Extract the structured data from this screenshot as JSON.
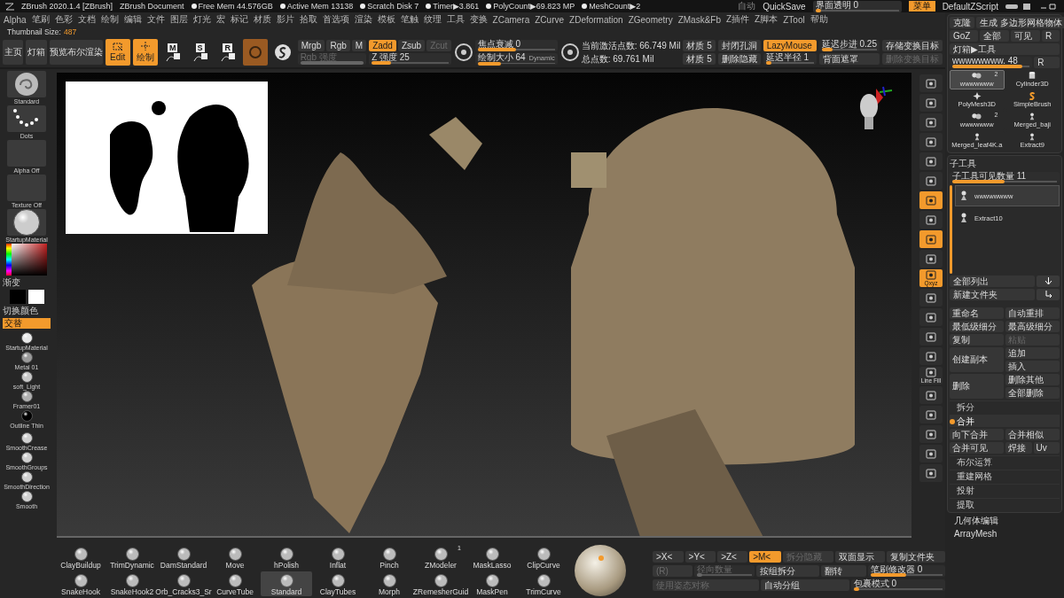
{
  "title_bar": {
    "app": "ZBrush 2020.1.4 [ZBrush]",
    "document": "ZBrush Document",
    "stats": [
      "Free Mem 44.576GB",
      "Active Mem 13138",
      "Scratch Disk 7",
      "Timer▶3.861",
      "PolyCount▶69.823 MP",
      "MeshCount▶2"
    ],
    "auto": "自动",
    "quicksave": "QuickSave",
    "opacity": {
      "label": "界面透明 0",
      "level": 0.05,
      "disabled": false
    },
    "menu_button": {
      "label": "菜单",
      "selected": true
    },
    "script": "DefaultZScript"
  },
  "menu": [
    "Alpha",
    "笔刷",
    "色彩",
    "文档",
    "绘制",
    "编辑",
    "文件",
    "图层",
    "灯光",
    "宏",
    "标记",
    "材质",
    "影片",
    "拾取",
    "首选项",
    "渲染",
    "模板",
    "笔触",
    "纹理",
    "工具",
    "变换",
    "ZCamera",
    "ZCurve",
    "ZDeformation",
    "ZGeometry",
    "ZMask&Fb",
    "Z插件",
    "Z脚本",
    "ZTool",
    "帮助"
  ],
  "thumbnail_size": {
    "label": "Thumbnail Size:",
    "value": "487"
  },
  "toolbar": {
    "nav": [
      "主页",
      "灯箱",
      "预览布尔渲染"
    ],
    "modes": [
      {
        "kind": "edit",
        "label": "Edit",
        "selected": true
      },
      {
        "kind": "draw",
        "label": "绘制",
        "selected": true
      },
      {
        "kind": "letter",
        "label": "M",
        "selected": false
      },
      {
        "kind": "letter",
        "label": "S",
        "selected": false
      },
      {
        "kind": "letter",
        "label": "R",
        "selected": false
      },
      {
        "kind": "material",
        "selected": true
      },
      {
        "kind": "shader",
        "selected": false
      }
    ],
    "groups": [
      {
        "kind": "plain",
        "rows": [
          [
            {
              "kind": "button",
              "label": "Mrgb",
              "selected": false,
              "disabled": false
            },
            {
              "kind": "button",
              "label": "Rgb",
              "selected": false,
              "disabled": false
            },
            {
              "kind": "button",
              "label": "M",
              "selected": false,
              "disabled": false
            }
          ],
          [
            {
              "kind": "slider",
              "label": "Rgb 强度",
              "level": 1,
              "disabled": true
            }
          ]
        ]
      },
      {
        "kind": "plain",
        "rows": [
          [
            {
              "kind": "button",
              "label": "Zadd",
              "selected": true,
              "disabled": false
            },
            {
              "kind": "button",
              "label": "Zsub",
              "selected": false,
              "disabled": false
            },
            {
              "kind": "button",
              "label": "Zcut",
              "selected": false,
              "disabled": true
            }
          ],
          [
            {
              "kind": "slider",
              "label": "Z 强度 25",
              "level": 0.25,
              "disabled": false
            }
          ]
        ]
      },
      {
        "kind": "target",
        "rows": [
          [
            {
              "kind": "slider",
              "label": "焦点衰减 0",
              "level": 0.5,
              "disabled": false
            }
          ],
          [
            {
              "kind": "slider",
              "label": "绘制大小 64",
              "tag": "Dynamic",
              "level": 0.3,
              "disabled": false
            }
          ]
        ]
      },
      {
        "kind": "target",
        "rows": [
          [
            {
              "kind": "text",
              "label": "当前激活点数: 66.749 Mil"
            }
          ],
          [
            {
              "kind": "text",
              "label": "总点数: 69.761 Mil"
            }
          ]
        ]
      },
      {
        "kind": "plain",
        "rows": [
          [
            {
              "kind": "button",
              "label": "材质 5",
              "selected": false,
              "disabled": false
            }
          ],
          [
            {
              "kind": "button",
              "label": "材质 5",
              "selected": false,
              "disabled": false
            }
          ]
        ]
      },
      {
        "kind": "plain",
        "rows": [
          [
            {
              "kind": "button",
              "label": "封闭孔洞",
              "selected": false,
              "disabled": false
            }
          ],
          [
            {
              "kind": "button",
              "label": "删除隐藏",
              "selected": false,
              "disabled": false
            }
          ]
        ]
      },
      {
        "kind": "plain",
        "rows": [
          [
            {
              "kind": "button",
              "label": "LazyMouse",
              "selected": true,
              "disabled": false
            }
          ],
          [
            {
              "kind": "slider",
              "label": "延迟半径 1",
              "level": 0.1,
              "disabled": false
            }
          ]
        ]
      },
      {
        "kind": "plain",
        "rows": [
          [
            {
              "kind": "slider",
              "label": "延迟步进 0.25",
              "level": 0.2,
              "disabled": false
            }
          ],
          [
            {
              "kind": "button",
              "label": "背面遮罩",
              "selected": false,
              "disabled": false
            }
          ]
        ]
      },
      {
        "kind": "plain",
        "rows": [
          [
            {
              "kind": "button",
              "label": "存储变换目标",
              "selected": false,
              "disabled": false
            }
          ],
          [
            {
              "kind": "button",
              "label": "删除变换目标",
              "selected": false,
              "disabled": true
            }
          ]
        ]
      }
    ]
  },
  "left_panel": [
    {
      "kind": "brush",
      "label": "Standard"
    },
    {
      "kind": "stroke",
      "label": "Dots"
    },
    {
      "kind": "blank",
      "label": "Alpha Off"
    },
    {
      "kind": "blank",
      "label": "Texture Off"
    },
    {
      "kind": "sphere",
      "label": "StartupMaterial"
    },
    {
      "kind": "picker",
      "label": "渐变"
    },
    {
      "kind": "swatches",
      "label": "切换颜色"
    },
    {
      "kind": "toggle",
      "label": "交替",
      "selected": true
    },
    {
      "kind": "ball",
      "label": "StartupMaterial",
      "color": "#e8e8e8"
    },
    {
      "kind": "ball",
      "label": "Metal 01",
      "color": "#9a9a9a"
    },
    {
      "kind": "ball",
      "label": "soft_Light",
      "color": "#c8c8c8"
    },
    {
      "kind": "ball",
      "label": "Framer01",
      "color": "#b0b0b0"
    },
    {
      "kind": "ball",
      "label": "Outline Thin",
      "color": "#000000"
    },
    {
      "kind": "ball",
      "label": "SmoothCrease",
      "color": "#d0d0d0"
    },
    {
      "kind": "ball",
      "label": "SmoothGroups",
      "color": "#d0d0d0"
    },
    {
      "kind": "ball",
      "label": "SmoothDirection",
      "color": "#d0d0d0"
    },
    {
      "kind": "ball",
      "label": "Smooth",
      "color": "#d0d0d0"
    }
  ],
  "right_shelf": [
    {
      "selected": false
    },
    {
      "selected": false
    },
    {
      "selected": false
    },
    {
      "selected": false
    },
    {
      "selected": false
    },
    {
      "selected": false
    },
    {
      "selected": true
    },
    {
      "selected": false
    },
    {
      "selected": true
    },
    {
      "selected": false
    },
    {
      "selected": true,
      "label": "Qxyz"
    },
    {
      "selected": false
    },
    {
      "selected": false
    },
    {
      "selected": false
    },
    {
      "selected": false
    },
    {
      "selected": false,
      "label": "Line Fill"
    },
    {
      "selected": false
    },
    {
      "selected": false
    },
    {
      "selected": false
    },
    {
      "selected": false
    },
    {
      "selected": false
    }
  ],
  "bottom": {
    "brushes": [
      {
        "label": "ClayBuildup",
        "selected": false
      },
      {
        "label": "TrimDynamic",
        "selected": false
      },
      {
        "label": "DamStandard",
        "selected": false
      },
      {
        "label": "Move",
        "selected": false
      },
      {
        "label": "hPolish",
        "selected": false
      },
      {
        "label": "Inflat",
        "selected": false
      },
      {
        "label": "Pinch",
        "selected": false
      },
      {
        "label": "ZModeler",
        "selected": false,
        "count": "1"
      },
      {
        "label": "MaskLasso",
        "selected": false
      },
      {
        "label": "ClipCurve",
        "selected": false
      },
      {
        "label": "SnakeHook",
        "selected": false
      },
      {
        "label": "SnakeHook2",
        "selected": false
      },
      {
        "label": "Orb_Cracks3_Sr",
        "selected": false
      },
      {
        "label": "CurveTube",
        "selected": false
      },
      {
        "label": "Standard",
        "selected": true
      },
      {
        "label": "ClayTubes",
        "selected": false
      },
      {
        "label": "Morph",
        "selected": false
      },
      {
        "label": "ZRemesherGuid",
        "selected": false
      },
      {
        "label": "MaskPen",
        "selected": false
      },
      {
        "label": "TrimCurve",
        "selected": false
      }
    ],
    "symmetry": [
      [
        {
          "kind": "button",
          "label": ">X<",
          "selected": false,
          "disabled": false
        },
        {
          "kind": "button",
          "label": ">Y<",
          "selected": false,
          "disabled": false
        },
        {
          "kind": "button",
          "label": ">Z<",
          "selected": false,
          "disabled": false
        },
        {
          "kind": "button",
          "label": ">M<",
          "selected": true,
          "disabled": false
        },
        {
          "kind": "button",
          "label": "拆分隐藏",
          "selected": false,
          "disabled": true
        },
        {
          "kind": "button",
          "label": "双面显示",
          "selected": false,
          "disabled": false
        },
        {
          "kind": "button",
          "label": "复制文件夹",
          "selected": false,
          "disabled": false
        }
      ],
      [
        {
          "kind": "button",
          "label": "(R)",
          "selected": false,
          "disabled": true
        },
        {
          "kind": "slider",
          "label": "径向数量",
          "level": 0.1,
          "disabled": true
        },
        {
          "kind": "button",
          "label": "按组拆分",
          "selected": false,
          "disabled": false
        },
        {
          "kind": "button",
          "label": "翻转",
          "selected": false,
          "disabled": false
        },
        {
          "kind": "slider",
          "label": "笔刷修改器 0",
          "level": 0.5,
          "disabled": false
        }
      ],
      [
        {
          "kind": "button",
          "label": "使用姿态对称",
          "selected": false,
          "disabled": true
        },
        {
          "kind": "button",
          "label": "自动分组",
          "selected": false,
          "disabled": false
        },
        {
          "kind": "slider",
          "label": "包裹模式 0",
          "level": 0.05,
          "disabled": false
        }
      ]
    ]
  },
  "right_panel": {
    "top_rows": [
      [
        {
          "kind": "button",
          "label": "克隆",
          "selected": false,
          "disabled": false
        },
        {
          "kind": "button",
          "label": "生成 多边形网格物体",
          "selected": false,
          "disabled": false
        }
      ],
      [
        {
          "kind": "button",
          "label": "GoZ",
          "selected": false,
          "disabled": false
        },
        {
          "kind": "button",
          "label": "全部",
          "selected": false,
          "disabled": false
        },
        {
          "kind": "button",
          "label": "可见",
          "selected": false,
          "disabled": false
        },
        {
          "kind": "button",
          "label": "R",
          "selected": false,
          "disabled": false
        }
      ],
      [
        {
          "kind": "button",
          "label": "灯箱▶工具",
          "selected": false,
          "disabled": false
        }
      ],
      [
        {
          "kind": "slider",
          "label": "wwwwwwww. 48",
          "level": 0.9,
          "disabled": false
        },
        {
          "kind": "button",
          "label": "R",
          "selected": false,
          "disabled": false
        }
      ]
    ],
    "tools": [
      {
        "kind": "multi",
        "label": "wwwwwww",
        "count": "2",
        "selected": true
      },
      {
        "kind": "cylinder",
        "label": "Cylinder3D",
        "selected": false
      },
      {
        "kind": "star",
        "label": "PolyMesh3D",
        "selected": false
      },
      {
        "kind": "sbrush",
        "label": "SimpleBrush",
        "selected": false
      },
      {
        "kind": "multi",
        "label": "wwwwwww",
        "count": "2",
        "selected": false
      },
      {
        "kind": "figure",
        "label": "Merged_baji",
        "selected": false
      },
      {
        "kind": "figure",
        "label": "Merged_leaf4K.a",
        "selected": false
      },
      {
        "kind": "figure",
        "label": "Extract9",
        "selected": false
      }
    ],
    "subtool": {
      "title": "子工具",
      "visible": {
        "label": "子工具可见数量 11",
        "level": 0.5,
        "disabled": false
      },
      "items": [
        {
          "label": "wwwwwwww",
          "selected": true
        },
        {
          "label": "Extract10",
          "selected": false
        }
      ]
    },
    "list_actions": [
      "全部列出",
      "新建文件夹"
    ],
    "actions": [
      {
        "kind": "pair",
        "items": [
          {
            "label": "重命名",
            "disabled": false
          },
          {
            "label": "自动重排",
            "disabled": false
          }
        ]
      },
      {
        "kind": "pair",
        "items": [
          {
            "label": "最低级细分",
            "disabled": false
          },
          {
            "label": "最高级细分",
            "disabled": false
          }
        ]
      },
      {
        "kind": "pair",
        "items": [
          {
            "label": "复制",
            "disabled": false
          },
          {
            "label": "粘贴",
            "disabled": true
          }
        ]
      },
      {
        "kind": "stack",
        "main": {
          "label": "创建副本",
          "disabled": false
        },
        "items": [
          {
            "label": "追加",
            "disabled": false
          },
          {
            "label": "插入",
            "disabled": false
          }
        ]
      },
      {
        "kind": "stack",
        "main": {
          "label": "删除",
          "disabled": false
        },
        "items": [
          {
            "label": "删除其他",
            "disabled": false
          },
          {
            "label": "全部删除",
            "disabled": false
          }
        ]
      }
    ],
    "sections": [
      {
        "label": "拆分",
        "selected": false
      },
      {
        "label": "合并",
        "selected": true,
        "items": [
          {
            "kind": "wide",
            "label": "向下合并"
          },
          {
            "kind": "wide",
            "label": "合并相似"
          },
          {
            "kind": "wide",
            "label": "合并可见"
          },
          {
            "kind": "button",
            "label": "焊接"
          },
          {
            "kind": "button",
            "label": "Uv"
          }
        ]
      },
      {
        "label": "布尔运算",
        "selected": false
      },
      {
        "label": "重建网格",
        "selected": false
      },
      {
        "label": "投射",
        "selected": false
      },
      {
        "label": "提取",
        "selected": false
      }
    ],
    "footer": [
      "几何体编辑",
      "ArrayMesh"
    ]
  }
}
